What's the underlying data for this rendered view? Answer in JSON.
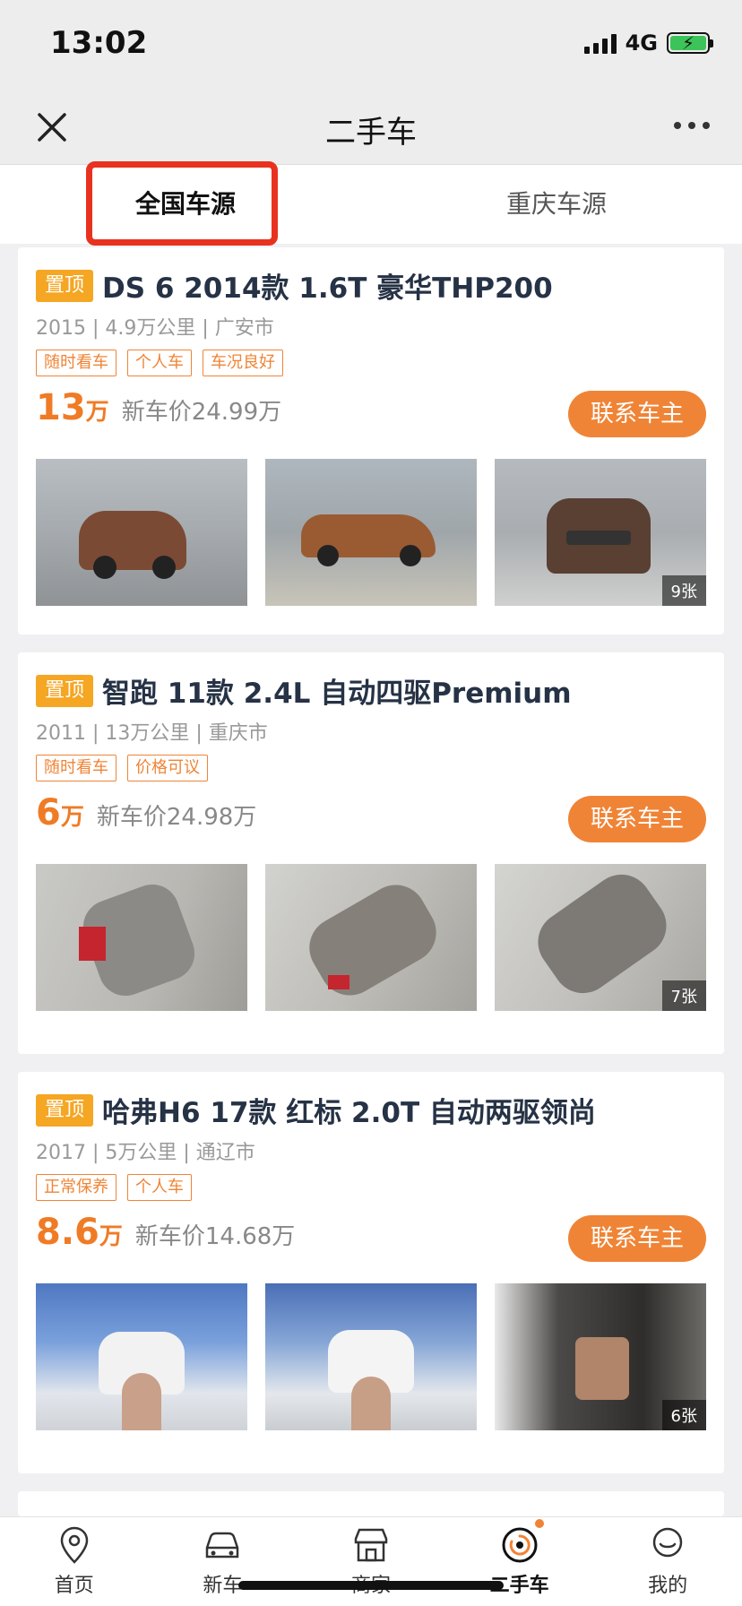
{
  "status_bar": {
    "time": "13:02",
    "network": "4G"
  },
  "nav": {
    "title": "二手车"
  },
  "tabs": [
    {
      "label": "全国车源",
      "active": true
    },
    {
      "label": "重庆车源",
      "active": false
    }
  ],
  "listings": [
    {
      "badge": "置顶",
      "title": "DS 6 2014款 1.6T 豪华THP200",
      "meta": "2015 | 4.9万公里 | 广安市",
      "tags": [
        "随时看车",
        "个人车",
        "车况良好"
      ],
      "price": "13",
      "price_unit": "万",
      "new_price": "新车价24.99万",
      "contact": "联系车主",
      "photo_count": "9张"
    },
    {
      "badge": "置顶",
      "title": "智跑 11款 2.4L 自动四驱Premium",
      "meta": "2011 | 13万公里 | 重庆市",
      "tags": [
        "随时看车",
        "价格可议"
      ],
      "price": "6",
      "price_unit": "万",
      "new_price": "新车价24.98万",
      "contact": "联系车主",
      "photo_count": "7张"
    },
    {
      "badge": "置顶",
      "title": "哈弗H6 17款 红标 2.0T 自动两驱领尚",
      "meta": "2017 | 5万公里 | 通辽市",
      "tags": [
        "正常保养",
        "个人车"
      ],
      "price": "8.6",
      "price_unit": "万",
      "new_price": "新车价14.68万",
      "contact": "联系车主",
      "photo_count": "6张"
    }
  ],
  "bottom_nav": [
    {
      "label": "首页",
      "icon": "location-pin-icon"
    },
    {
      "label": "新车",
      "icon": "car-icon"
    },
    {
      "label": "商家",
      "icon": "store-icon"
    },
    {
      "label": "二手车",
      "icon": "used-car-icon",
      "active": true
    },
    {
      "label": "我的",
      "icon": "profile-icon"
    }
  ],
  "colors": {
    "accent": "#f08436",
    "pin_badge": "#f5a623",
    "highlight_box": "#e8321f",
    "title_text": "#263245"
  }
}
